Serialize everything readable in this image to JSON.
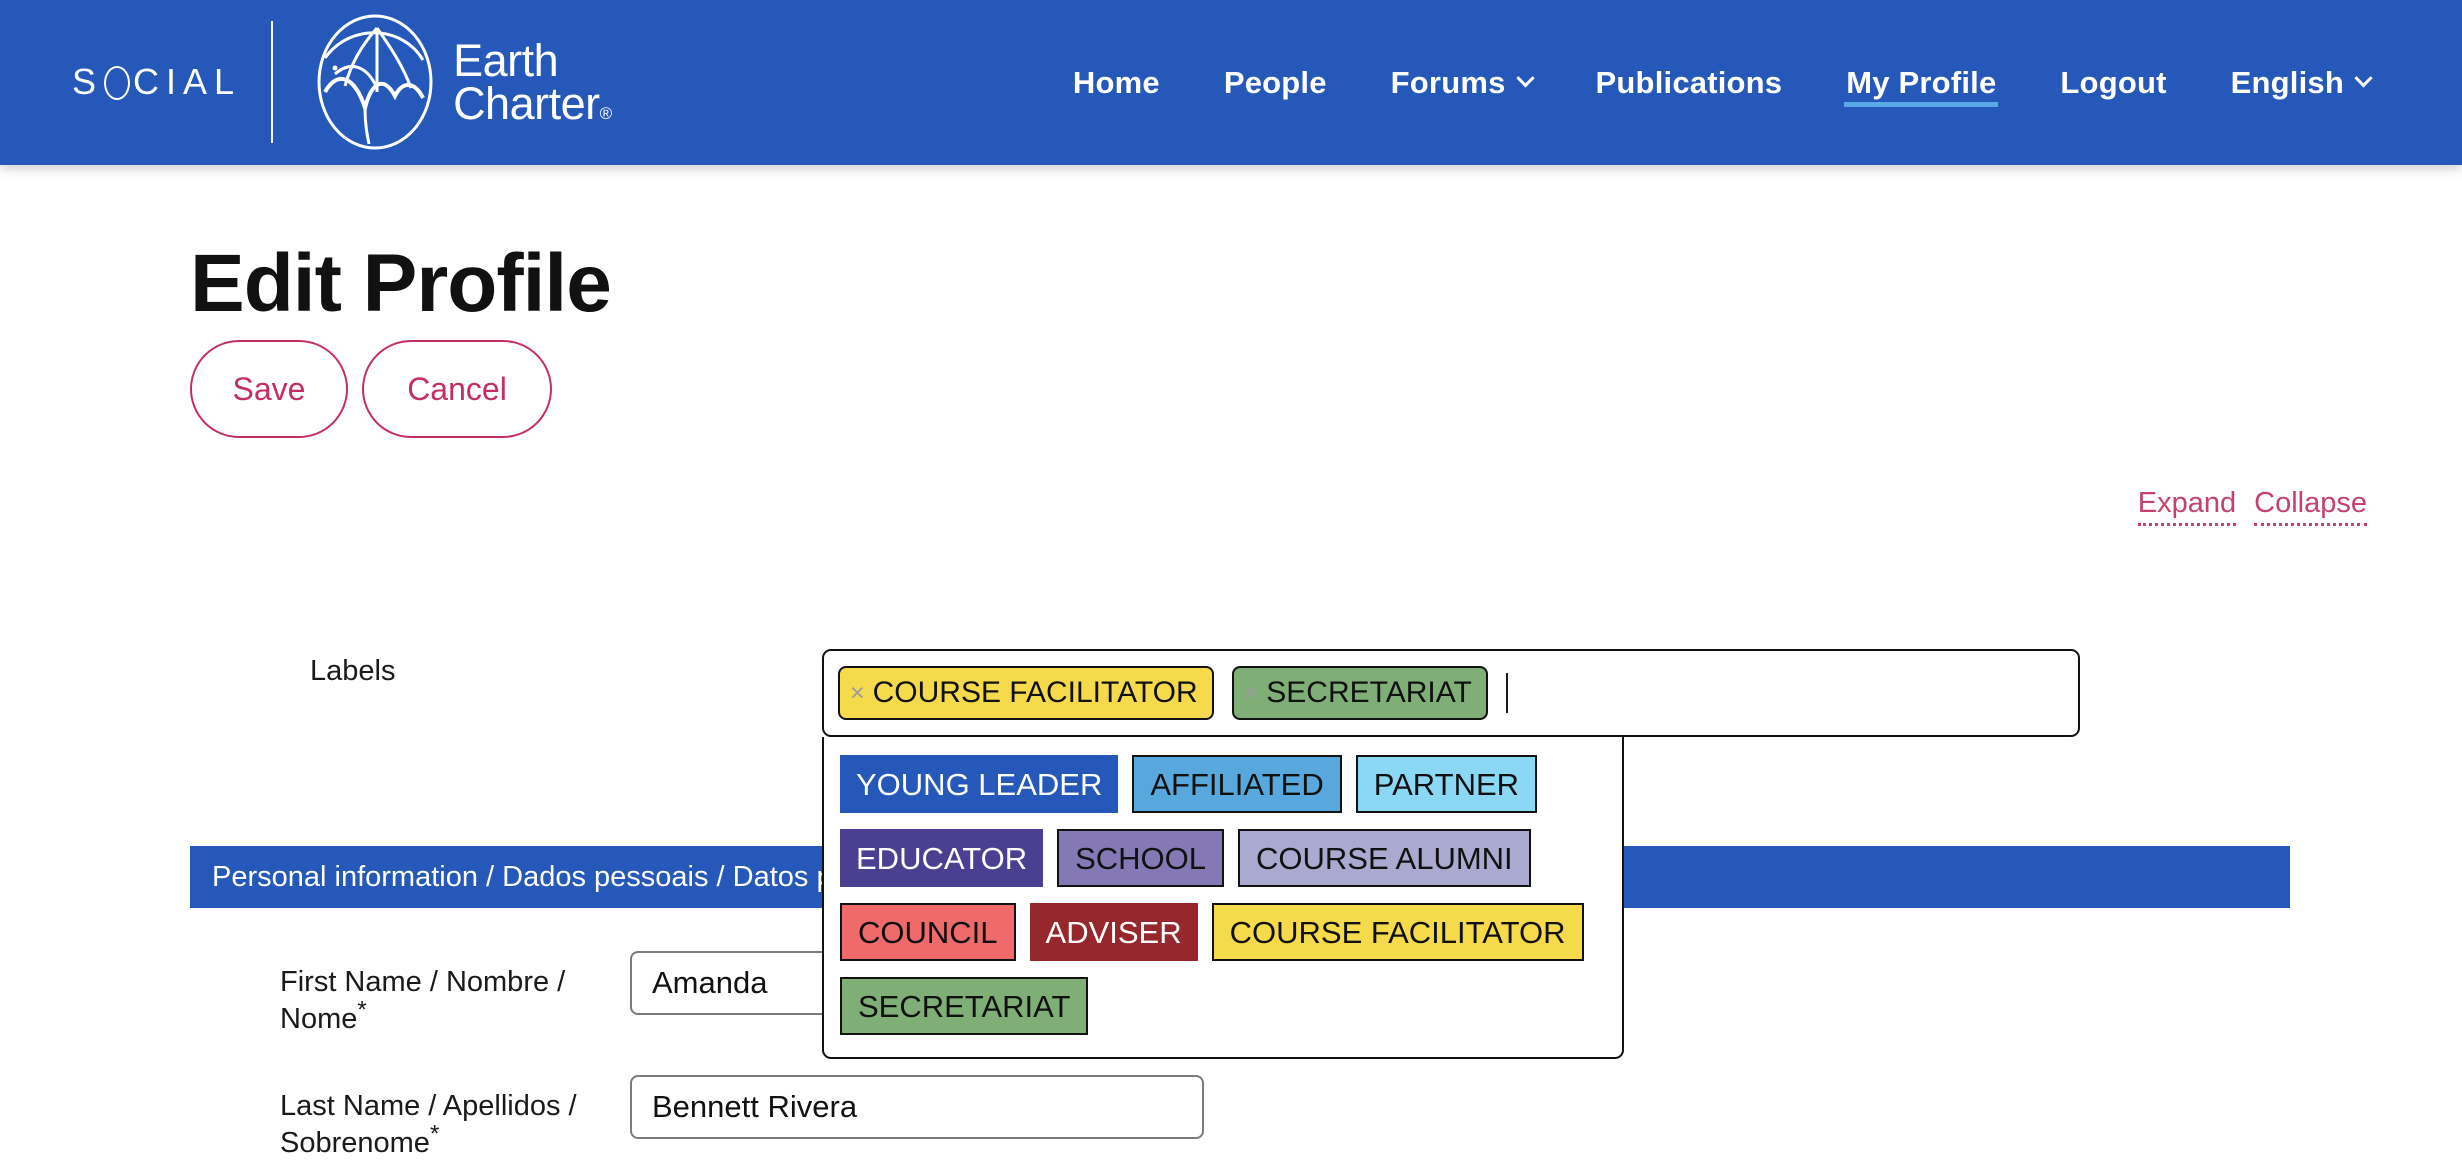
{
  "header": {
    "brand": {
      "social": "SOCIAL",
      "earth": "Earth",
      "charter": "Charter",
      "registered": "®"
    },
    "nav": [
      {
        "label": "Home",
        "active": false,
        "caret": false
      },
      {
        "label": "People",
        "active": false,
        "caret": false
      },
      {
        "label": "Forums",
        "active": false,
        "caret": true
      },
      {
        "label": "Publications",
        "active": false,
        "caret": false
      },
      {
        "label": "My Profile",
        "active": true,
        "caret": false
      },
      {
        "label": "Logout",
        "active": false,
        "caret": false
      },
      {
        "label": "English",
        "active": false,
        "caret": true
      }
    ],
    "accent_bg": "#2558b8",
    "active_underline": "#5aa9e6"
  },
  "page": {
    "title": "Edit Profile",
    "save_label": "Save",
    "cancel_label": "Cancel",
    "expand_label": "Expand",
    "collapse_label": "Collapse",
    "labels_field_label": "Labels",
    "section_bar_text": "Personal information / Dados pessoais / Datos personales",
    "accent_link_color": "#c42f62"
  },
  "labels_widget": {
    "selected": [
      {
        "text": "COURSE FACILITATOR",
        "bg": "#f5da4c",
        "fg": "#111111",
        "remove_icon": "×"
      },
      {
        "text": "SECRETARIAT",
        "bg": "#7fae76",
        "fg": "#111111",
        "remove_icon": "×"
      }
    ],
    "options": [
      {
        "text": "YOUNG LEADER",
        "bg": "#2558b8",
        "fg": "#ffffff",
        "bordered": false
      },
      {
        "text": "AFFILIATED",
        "bg": "#58a8de",
        "fg": "#111111",
        "bordered": true
      },
      {
        "text": "PARTNER",
        "bg": "#8bd8f5",
        "fg": "#111111",
        "bordered": true
      },
      {
        "text": "EDUCATOR",
        "bg": "#4a3f90",
        "fg": "#ffffff",
        "bordered": false
      },
      {
        "text": "SCHOOL",
        "bg": "#8479b5",
        "fg": "#111111",
        "bordered": true
      },
      {
        "text": "COURSE ALUMNI",
        "bg": "#aaa9cf",
        "fg": "#111111",
        "bordered": true
      },
      {
        "text": "COUNCIL",
        "bg": "#ef6a6a",
        "fg": "#111111",
        "bordered": true
      },
      {
        "text": "ADVISER",
        "bg": "#96282d",
        "fg": "#ffffff",
        "bordered": false
      },
      {
        "text": "COURSE FACILITATOR",
        "bg": "#f5da4c",
        "fg": "#111111",
        "bordered": true
      },
      {
        "text": "SECRETARIAT",
        "bg": "#7fae76",
        "fg": "#111111",
        "bordered": true
      }
    ]
  },
  "form": {
    "fields": [
      {
        "label": "First Name / Nombre / Nome",
        "required_mark": "*",
        "value": "Amanda",
        "placeholder": ""
      },
      {
        "label": "Last Name / Apellidos / Sobrenome",
        "required_mark": "*",
        "value": "Bennett Rivera",
        "placeholder": ""
      }
    ]
  }
}
